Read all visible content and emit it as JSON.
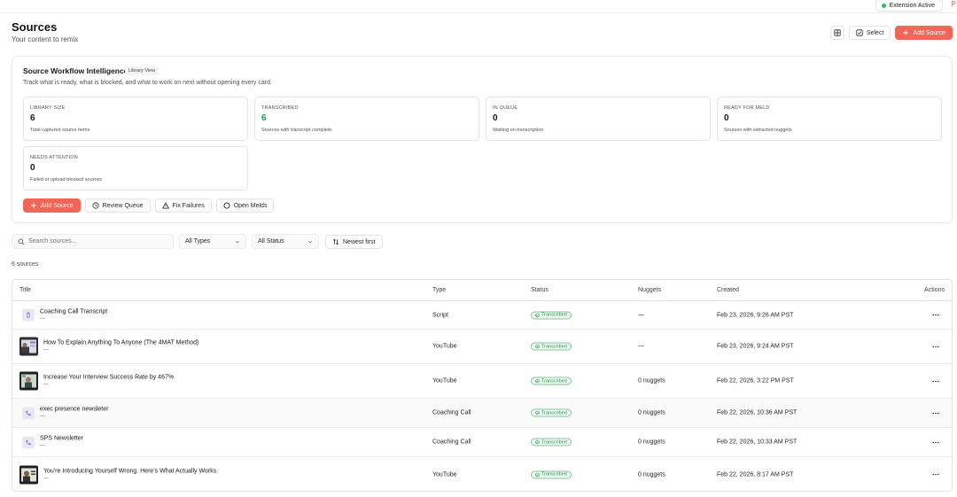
{
  "extension": {
    "status_label": "Extension Active",
    "edge_letter": "P"
  },
  "header": {
    "title": "Sources",
    "subtitle": "Your content to remix",
    "select_label": "Select",
    "add_label": "Add Source"
  },
  "intel": {
    "title": "Source Workflow Intelligence",
    "pill": "Library View",
    "description": "Track what is ready, what is blocked, and what to work on next without opening every card.",
    "stats": [
      {
        "label": "LIBRARY SIZE",
        "value": "6",
        "hint": "Total captured source items"
      },
      {
        "label": "TRANSCRIBED",
        "value": "6",
        "hint": "Sources with transcript complete"
      },
      {
        "label": "IN QUEUE",
        "value": "0",
        "hint": "Waiting on transcription"
      },
      {
        "label": "READY FOR MELD",
        "value": "0",
        "hint": "Sources with extracted nuggets"
      },
      {
        "label": "NEEDS ATTENTION",
        "value": "0",
        "hint": "Failed or upload-blocked sources"
      }
    ],
    "actions": {
      "add": "Add Source",
      "review": "Review Queue",
      "fix": "Fix Failures",
      "melds": "Open Melds"
    }
  },
  "filters": {
    "search_placeholder": "Search sources...",
    "type_value": "All Types",
    "status_value": "All Status",
    "sort_label": "Newest first"
  },
  "count_label": "6 sources",
  "table": {
    "columns": {
      "title": "Title",
      "type": "Type",
      "status": "Status",
      "nuggets": "Nuggets",
      "created": "Created",
      "actions": "Actions"
    },
    "rows": [
      {
        "title": "Coaching Call Transcript",
        "sub": "—",
        "type": "Script",
        "status": "Transcribed",
        "nuggets": "—",
        "created": "Feb 23, 2026, 9:26 AM PST",
        "thumb": "document-icon"
      },
      {
        "title": "How To Explain Anything To Anyone (The 4MAT Method)",
        "sub": "—",
        "type": "YouTube",
        "status": "Transcribed",
        "nuggets": "—",
        "created": "Feb 23, 2026, 9:24 AM PST",
        "thumb": "video-thumbnail"
      },
      {
        "title": "Increase Your Interview Success Rate by 467%",
        "sub": "—",
        "type": "YouTube",
        "status": "Transcribed",
        "nuggets": "0 nuggets",
        "created": "Feb 22, 2026, 3:22 PM PST",
        "thumb": "video-thumbnail"
      },
      {
        "title": "exec presence newsleter",
        "sub": "—",
        "type": "Coaching Call",
        "status": "Transcribed",
        "nuggets": "0 nuggets",
        "created": "Feb 22, 2026, 10:36 AM PST",
        "thumb": "phone-icon"
      },
      {
        "title": "SPS Newsletter",
        "sub": "—",
        "type": "Coaching Call",
        "status": "Transcribed",
        "nuggets": "0 nuggets",
        "created": "Feb 22, 2026, 10:33 AM PST",
        "thumb": "phone-icon"
      },
      {
        "title": "You're Introducing Yourself Wrong. Here's What Actually Works.",
        "sub": "—",
        "type": "YouTube",
        "status": "Transcribed",
        "nuggets": "0 nuggets",
        "created": "Feb 22, 2026, 8:17 AM PST",
        "thumb": "video-thumbnail"
      }
    ]
  },
  "colors": {
    "accent": "#f0675a",
    "success": "#16a34a",
    "badge_bg": "#eefaf1",
    "icon_bg": "#e8e8f4"
  }
}
